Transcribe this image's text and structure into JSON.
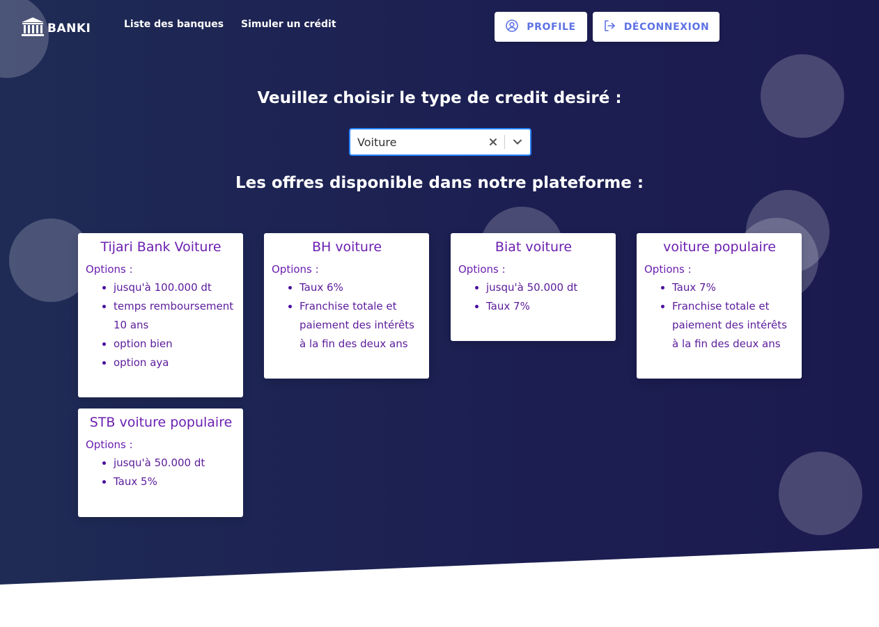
{
  "brand": {
    "name": "BANKI"
  },
  "nav": {
    "banks": "Liste des banques",
    "simulate": "Simuler un crédit"
  },
  "header_buttons": {
    "profile": "PROFILE",
    "logout": "DÉCONNEXION"
  },
  "main": {
    "choose_title": "Veuillez choisir le type de credit desiré :",
    "credit_select": {
      "value": "Voiture"
    },
    "offers_title": "Les offres disponible dans notre plateforme :"
  },
  "offers": [
    {
      "title": "Tijari Bank Voiture",
      "options_label": "Options :",
      "items": [
        "jusqu'à 100.000 dt",
        "temps remboursement 10 ans",
        "option bien",
        "option aya"
      ]
    },
    {
      "title": "BH voiture",
      "options_label": "Options :",
      "items": [
        "Taux 6%",
        "Franchise totale et paiement des intérêts à la fin des deux ans"
      ]
    },
    {
      "title": "Biat voiture",
      "options_label": "Options :",
      "items": [
        "jusqu'à 50.000 dt",
        "Taux 7%"
      ]
    },
    {
      "title": "voiture populaire",
      "options_label": "Options :",
      "items": [
        "Taux 7%",
        "Franchise totale et paiement des intérêts à la fin des deux ans"
      ]
    },
    {
      "title": "STB voiture populaire",
      "options_label": "Options :",
      "items": [
        "jusqu'à 50.000 dt",
        "Taux 5%"
      ]
    }
  ],
  "colors": {
    "accent": "#5e72e4",
    "card_text": "#6a1fb0",
    "focus_border": "#2684ff",
    "hero_bg": "#1c1f52"
  },
  "icons": [
    "bank-logo-icon",
    "user-circle-icon",
    "logout-icon",
    "clear-icon",
    "chevron-down-icon"
  ]
}
